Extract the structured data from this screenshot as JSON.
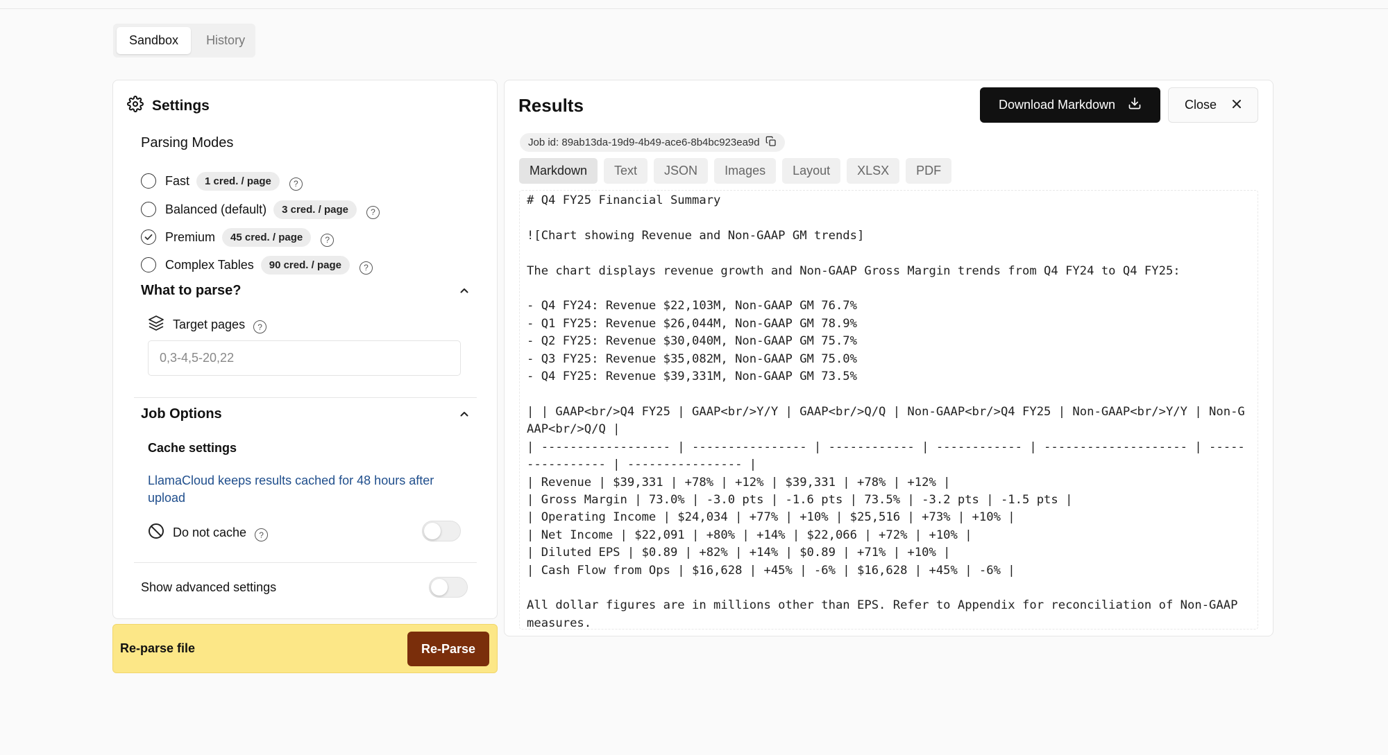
{
  "top_tabs": [
    "Sandbox",
    "History"
  ],
  "settings": {
    "title": "Settings",
    "parsing_modes_label": "Parsing Modes",
    "modes": [
      {
        "name": "Fast",
        "badge": "1 cred. / page",
        "selected": false
      },
      {
        "name": "Balanced (default)",
        "badge": "3 cred. / page",
        "selected": false
      },
      {
        "name": "Premium",
        "badge": "45 cred. / page",
        "selected": true
      },
      {
        "name": "Complex Tables",
        "badge": "90 cred. / page",
        "selected": false
      }
    ],
    "what_to_parse": {
      "label": "What to parse?",
      "target_pages_label": "Target pages",
      "target_pages_placeholder": "0,3-4,5-20,22"
    },
    "job_options": {
      "label": "Job Options",
      "cache_label": "Cache settings",
      "cache_note": "LlamaCloud keeps results cached for 48 hours after upload",
      "do_not_cache_label": "Do not cache",
      "do_not_cache_on": false
    },
    "advanced_label": "Show advanced settings",
    "advanced_on": false
  },
  "reparse": {
    "label": "Re-parse file",
    "button": "Re-Parse"
  },
  "results": {
    "title": "Results",
    "download_label": "Download Markdown",
    "close_label": "Close",
    "job_id": "Job id: 89ab13da-19d9-4b49-ace6-8b4bc923ea9d",
    "tabs": [
      "Markdown",
      "Text",
      "JSON",
      "Images",
      "Layout",
      "XLSX",
      "PDF"
    ],
    "active_tab": "Markdown",
    "markdown": "# Q4 FY25 Financial Summary\n\n![Chart showing Revenue and Non-GAAP GM trends]\n\nThe chart displays revenue growth and Non-GAAP Gross Margin trends from Q4 FY24 to Q4 FY25:\n\n- Q4 FY24: Revenue $22,103M, Non-GAAP GM 76.7%\n- Q1 FY25: Revenue $26,044M, Non-GAAP GM 78.9%\n- Q2 FY25: Revenue $30,040M, Non-GAAP GM 75.7%\n- Q3 FY25: Revenue $35,082M, Non-GAAP GM 75.0%\n- Q4 FY25: Revenue $39,331M, Non-GAAP GM 73.5%\n\n| | GAAP<br/>Q4 FY25 | GAAP<br/>Y/Y | GAAP<br/>Q/Q | Non-GAAP<br/>Q4 FY25 | Non-GAAP<br/>Y/Y | Non-GAAP<br/>Q/Q |\n| ------------------ | ---------------- | ------------ | ------------ | -------------------- | ---------------- | ---------------- |\n| Revenue | $39,331 | +78% | +12% | $39,331 | +78% | +12% |\n| Gross Margin | 73.0% | -3.0 pts | -1.6 pts | 73.5% | -3.2 pts | -1.5 pts |\n| Operating Income | $24,034 | +77% | +10% | $25,516 | +73% | +10% |\n| Net Income | $22,091 | +80% | +14% | $22,066 | +72% | +10% |\n| Diluted EPS | $0.89 | +82% | +14% | $0.89 | +71% | +10% |\n| Cash Flow from Ops | $16,628 | +45% | -6% | $16,628 | +45% | -6% |\n\nAll dollar figures are in millions other than EPS. Refer to Appendix for reconciliation of Non-GAAP measures."
  }
}
